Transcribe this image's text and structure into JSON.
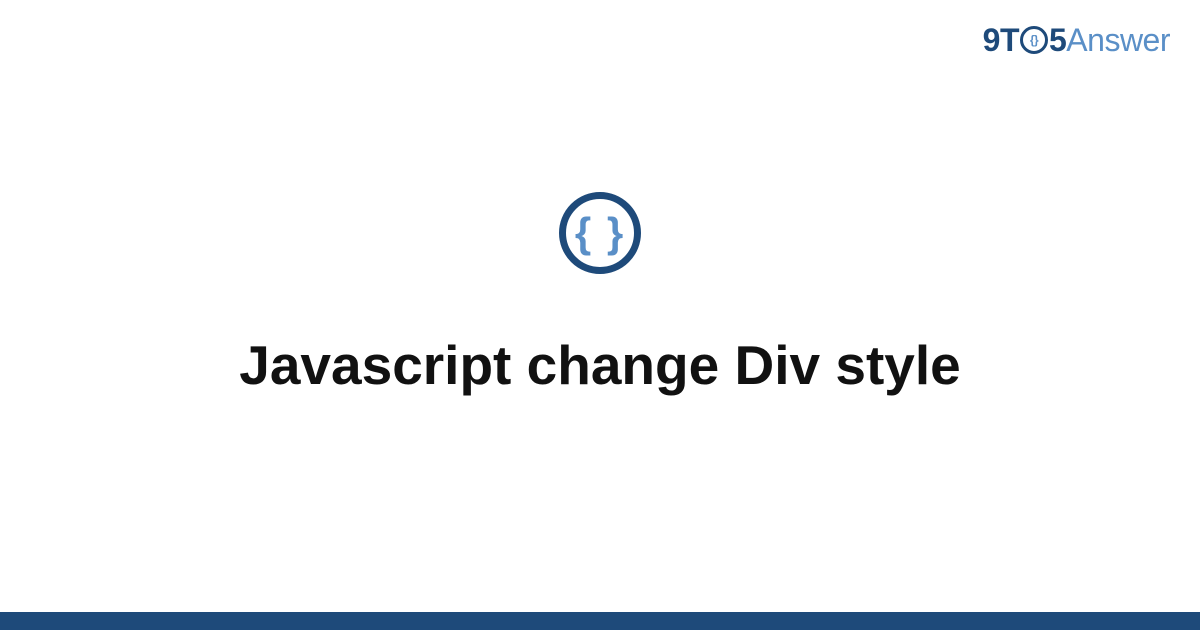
{
  "brand": {
    "part1": "9T",
    "circle_inner": "{}",
    "part2": "5",
    "part3": "Answer"
  },
  "icon": {
    "glyph": "{ }"
  },
  "title": "Javascript change Div style"
}
